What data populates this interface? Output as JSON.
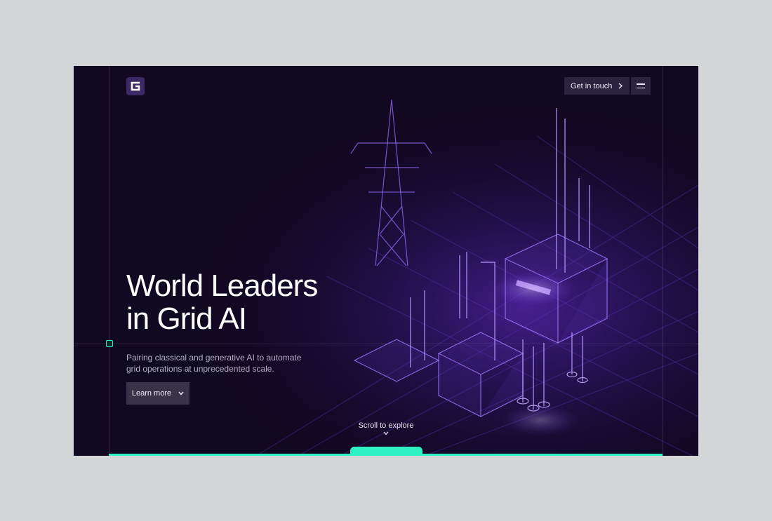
{
  "brand": {
    "logo_letter": "G",
    "accent": "#2ef2c4",
    "background": "#110821",
    "glow": "#7b3cff"
  },
  "header": {
    "contact_label": "Get in touch",
    "contact_icon": "chevron-right-icon",
    "menu_icon": "hamburger-menu-icon"
  },
  "hero": {
    "headline_line1": "World Leaders",
    "headline_line2": "in Grid AI",
    "subtitle": "Pairing classical and generative AI to automate grid operations at unprecedented scale.",
    "cta_label": "Learn more",
    "cta_icon": "chevron-down-icon"
  },
  "scroll": {
    "label": "Scroll to explore",
    "icon": "chevron-down-icon"
  }
}
